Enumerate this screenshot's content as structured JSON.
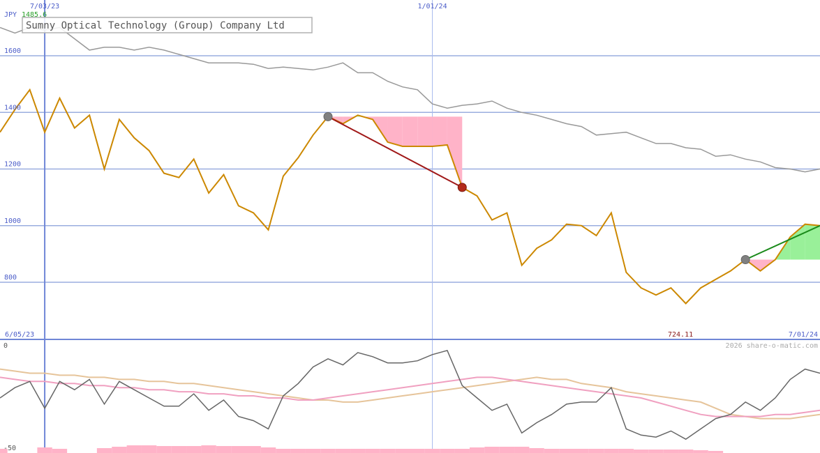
{
  "colors": {
    "background": "#ffffff",
    "grid": "#9aaedf",
    "gridV": "#a9baee",
    "divider": "#6f86d6",
    "price": "#cc8800",
    "index": "#999999",
    "trade_loss": "#a01818",
    "trade_gain": "#1a8a1a",
    "fill_loss": "#ffb3c8",
    "fill_gain": "#99f099",
    "marker_entry": "#808080",
    "marker_exit": "#b42a1a",
    "osc_main": "#666666",
    "osc_pink": "#f0a0c0",
    "osc_tan": "#e6c49a",
    "volume": "#ffb3c8",
    "axis_text": "#4a5cc8",
    "currency_text": "#4a5cc8",
    "last_value_text": "#2aa02a",
    "low_text": "#8a1a1a"
  },
  "header": {
    "currency": "JPY",
    "last_value": "1485.6",
    "company_name": "Sumny Optical Technology (Group) Company Ltd"
  },
  "footer": {
    "low_value_label": "724.11",
    "watermark": "2026 share-o-matic.com"
  },
  "chart_data": {
    "type": "line",
    "title": "Sumny Optical Technology (Group) Company Ltd",
    "y_unit": "JPY",
    "ylim": [
      660,
      1850
    ],
    "y_ticks": [
      800,
      1000,
      1200,
      1400,
      1600
    ],
    "y_tick_labels": [
      "800",
      "1000",
      "1200",
      "1400",
      "1600"
    ],
    "x_range_weeks": [
      0,
      55
    ],
    "top_date_labels": [
      {
        "label": "7/03/23",
        "week": 3
      },
      {
        "label": "1/01/24",
        "week": 29
      }
    ],
    "bottom_date_labels": [
      {
        "label": "6/05/23",
        "week": 0,
        "align": "left"
      },
      {
        "label": "7/01/24",
        "week": 55,
        "align": "right"
      }
    ],
    "series": [
      {
        "name": "Sumny Optical Technology (Group) Company Ltd",
        "week": [
          0,
          1,
          2,
          3,
          4,
          5,
          6,
          7,
          8,
          9,
          10,
          11,
          12,
          13,
          14,
          15,
          16,
          17,
          18,
          19,
          20,
          21,
          22,
          23,
          24,
          25,
          26,
          27,
          28,
          29,
          30,
          31,
          32,
          33,
          34,
          35,
          36,
          37,
          38,
          39,
          40,
          41,
          42,
          43,
          44,
          45,
          46,
          47,
          48,
          49,
          50,
          51,
          52,
          53,
          54,
          55
        ],
        "values": [
          1330,
          1410,
          1480,
          1330,
          1450,
          1345,
          1390,
          1200,
          1375,
          1310,
          1265,
          1185,
          1170,
          1235,
          1115,
          1180,
          1070,
          1045,
          985,
          1175,
          1240,
          1320,
          1385,
          1360,
          1390,
          1375,
          1295,
          1280,
          1280,
          1280,
          1285,
          1135,
          1105,
          1020,
          1045,
          860,
          920,
          950,
          1005,
          1000,
          965,
          1045,
          835,
          780,
          755,
          780,
          725,
          780,
          810,
          840,
          880,
          840,
          880,
          960,
          1005,
          1000
        ]
      },
      {
        "name": "index",
        "week": [
          0,
          1,
          2,
          3,
          4,
          5,
          6,
          7,
          8,
          9,
          10,
          11,
          12,
          13,
          14,
          15,
          16,
          17,
          18,
          19,
          20,
          21,
          22,
          23,
          24,
          25,
          26,
          27,
          28,
          29,
          30,
          31,
          32,
          33,
          34,
          35,
          36,
          37,
          38,
          39,
          40,
          41,
          42,
          43,
          44,
          45,
          46,
          47,
          48,
          49,
          50,
          51,
          52,
          53,
          54,
          55
        ],
        "values": [
          1700,
          1680,
          1700,
          1690,
          1700,
          1660,
          1620,
          1630,
          1630,
          1620,
          1630,
          1620,
          1605,
          1590,
          1575,
          1575,
          1575,
          1570,
          1555,
          1560,
          1555,
          1550,
          1560,
          1575,
          1540,
          1540,
          1510,
          1490,
          1480,
          1430,
          1415,
          1425,
          1430,
          1440,
          1415,
          1400,
          1390,
          1375,
          1360,
          1350,
          1320,
          1325,
          1330,
          1310,
          1290,
          1290,
          1275,
          1270,
          1245,
          1250,
          1235,
          1225,
          1205,
          1200,
          1190,
          1200
        ]
      }
    ],
    "trades": [
      {
        "from_week": 22,
        "from_value": 1385,
        "to_week": 31,
        "to_value": 1135,
        "result": "loss"
      },
      {
        "from_week": 50,
        "from_value": 880,
        "to_week": 55,
        "to_value": 1000,
        "result": "gain"
      }
    ],
    "oscillator": {
      "ylim": [
        -50,
        0
      ],
      "tick_labels": [
        "0",
        "-50"
      ],
      "main": [
        -25,
        -20,
        -17,
        -30,
        -17,
        -21,
        -16,
        -28,
        -17,
        -21,
        -25,
        -29,
        -29,
        -23,
        -31,
        -26,
        -34,
        -36,
        -40,
        -24,
        -18,
        -10,
        -6,
        -9,
        -3,
        -5,
        -8,
        -8,
        -7,
        -4,
        -2,
        -19,
        -25,
        -31,
        -28,
        -42,
        -37,
        -33,
        -28,
        -27,
        -27,
        -20,
        -40,
        -43,
        -44,
        -41,
        -45,
        -40,
        -35,
        -33,
        -27,
        -31,
        -25,
        -16,
        -11,
        -13
      ],
      "pink": [
        -15,
        -16,
        -17,
        -17,
        -18,
        -18,
        -19,
        -19,
        -20,
        -20,
        -21,
        -21,
        -22,
        -22,
        -23,
        -23,
        -24,
        -24,
        -25,
        -25,
        -26,
        -26,
        -25,
        -24,
        -23,
        -22,
        -21,
        -20,
        -19,
        -18,
        -17,
        -16,
        -15,
        -15,
        -16,
        -17,
        -18,
        -19,
        -20,
        -21,
        -22,
        -23,
        -24,
        -25,
        -27,
        -29,
        -31,
        -33,
        -34,
        -34,
        -34,
        -34,
        -33,
        -33,
        -32,
        -31
      ],
      "tan": [
        -11,
        -12,
        -13,
        -13,
        -14,
        -14,
        -15,
        -15,
        -16,
        -16,
        -17,
        -17,
        -18,
        -18,
        -19,
        -20,
        -21,
        -22,
        -23,
        -24,
        -25,
        -26,
        -26,
        -27,
        -27,
        -26,
        -25,
        -24,
        -23,
        -22,
        -21,
        -20,
        -19,
        -18,
        -17,
        -16,
        -15,
        -16,
        -16,
        -18,
        -19,
        -20,
        -22,
        -23,
        -24,
        -25,
        -26,
        -27,
        -30,
        -33,
        -34,
        -35,
        -35,
        -35,
        -34,
        -33
      ]
    },
    "volume": {
      "week": [
        0,
        3,
        4,
        7,
        8,
        9,
        10,
        11,
        12,
        13,
        14,
        15,
        16,
        17,
        18,
        19,
        20,
        21,
        22,
        23,
        24,
        25,
        26,
        27,
        28,
        29,
        30,
        31,
        32,
        33,
        34,
        35,
        36,
        37,
        38,
        39,
        40,
        41,
        42,
        43,
        44,
        45,
        46,
        47,
        48
      ],
      "values": [
        0.3,
        0.4,
        0.3,
        0.35,
        0.45,
        0.55,
        0.55,
        0.5,
        0.5,
        0.5,
        0.55,
        0.5,
        0.5,
        0.5,
        0.4,
        0.3,
        0.3,
        0.3,
        0.3,
        0.3,
        0.3,
        0.3,
        0.3,
        0.3,
        0.3,
        0.3,
        0.3,
        0.3,
        0.4,
        0.45,
        0.45,
        0.45,
        0.35,
        0.3,
        0.3,
        0.3,
        0.3,
        0.3,
        0.3,
        0.25,
        0.25,
        0.25,
        0.25,
        0.2,
        0.15
      ]
    }
  }
}
